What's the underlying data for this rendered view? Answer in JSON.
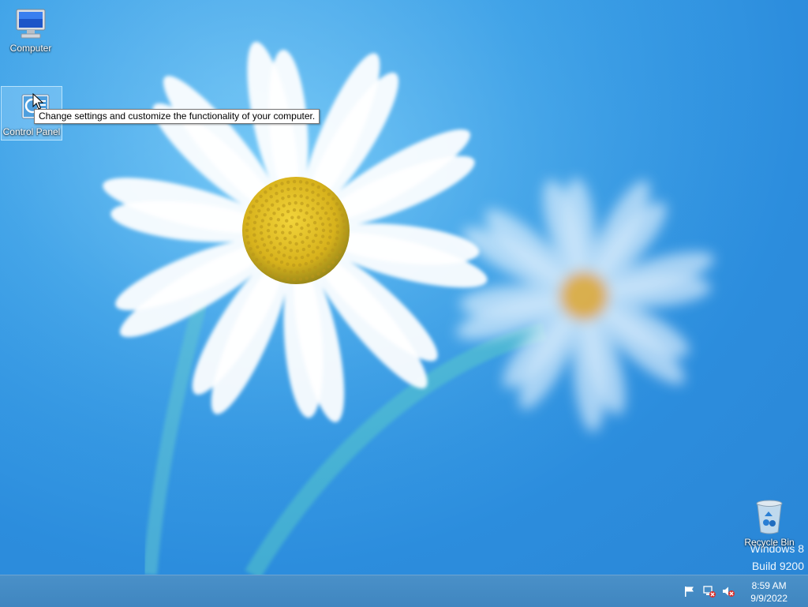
{
  "desktop": {
    "icons": [
      {
        "label": "Computer",
        "icon": "computer-icon"
      },
      {
        "label": "Control Panel",
        "icon": "control-panel-icon",
        "selected": true
      },
      {
        "label": "Recycle Bin",
        "icon": "recycle-bin-icon"
      }
    ],
    "tooltip": "Change settings and customize the functionality of your computer.",
    "watermark": {
      "line1": "Windows 8",
      "line2": "Build 9200"
    }
  },
  "taskbar": {
    "tray_icons": [
      "action-center-flag-icon",
      "network-disconnected-icon",
      "volume-muted-icon"
    ],
    "clock": {
      "time": "8:59 AM",
      "date": "9/9/2022"
    }
  }
}
